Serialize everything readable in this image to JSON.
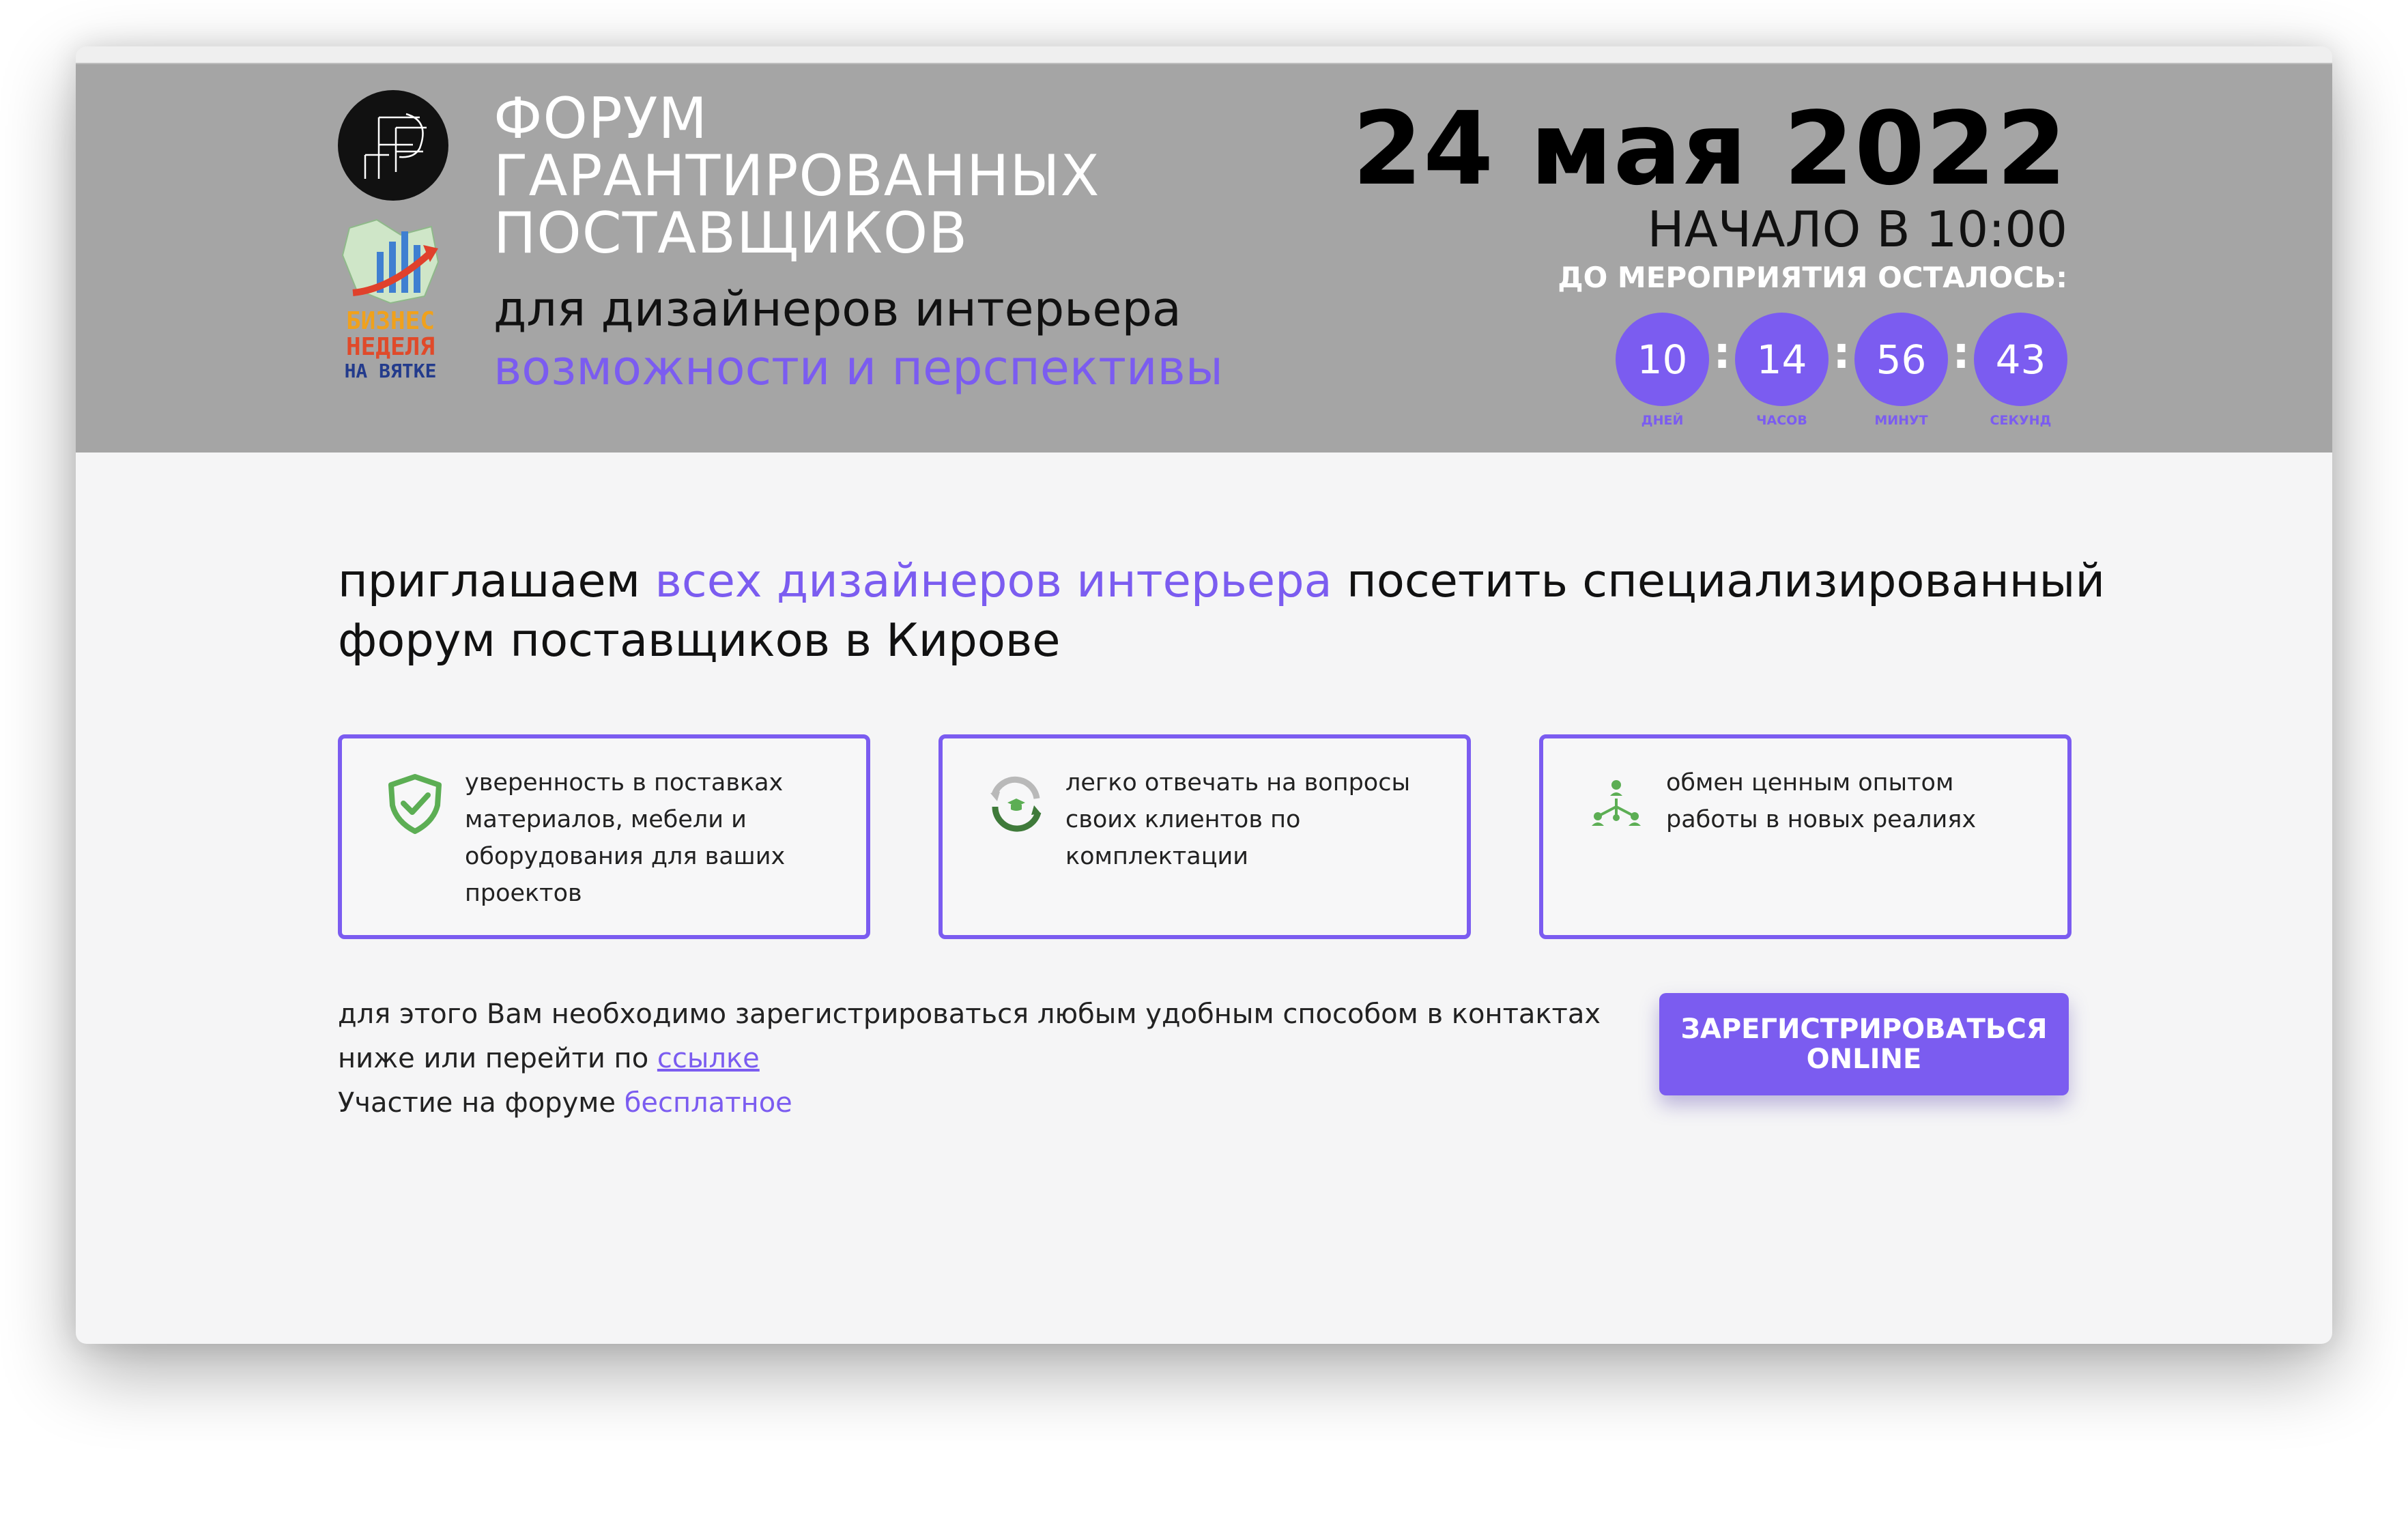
{
  "header": {
    "title_lines": [
      "ФОРУМ",
      "ГАРАНТИРОВАННЫХ",
      "ПОСТАВЩИКОВ"
    ],
    "subtitle": "для дизайнеров интерьера",
    "tagline": "возможности и перспективы",
    "logo_secondary_lines": [
      "БИЗНЕС",
      "НЕДЕЛЯ",
      "НА ВЯТКЕ"
    ],
    "date": "24 мая 2022",
    "start_time": "НАЧАЛО В 10:00",
    "countdown_label": "ДО МЕРОПРИЯТИЯ ОСТАЛОСЬ:",
    "countdown": [
      {
        "value": "10",
        "label": "ДНЕЙ"
      },
      {
        "value": "14",
        "label": "ЧАСОВ"
      },
      {
        "value": "56",
        "label": "МИНУТ"
      },
      {
        "value": "43",
        "label": "СЕКУНД"
      }
    ],
    "countdown_separator": ":"
  },
  "invite": {
    "part1": "приглашаем ",
    "accent": "всех дизайнеров интерьера",
    "part2": " посетить специализированный форум поставщиков в Кирове"
  },
  "cards": [
    {
      "icon": "shield-check-icon",
      "text": "уверенность в поставках материалов, мебели и оборудования для ваших проектов"
    },
    {
      "icon": "cycle-graduation-icon",
      "text": "легко отвечать на вопросы своих клиентов по комплектации"
    },
    {
      "icon": "network-people-icon",
      "text": "обмен ценным опытом работы в новых реалиях"
    }
  ],
  "note": {
    "line1": "для этого Вам необходимо зарегистрироваться любым удобным способом в контактах ниже или перейти по ",
    "link": "ссылке",
    "line2_prefix": "Участие на форуме ",
    "free": "бесплатное"
  },
  "register_button": "ЗАРЕГИСТРИРОВАТЬСЯ ONLINE",
  "colors": {
    "accent": "#7b5cf0",
    "header_bg": "#a5a5a5",
    "page_bg": "#f5f5f6",
    "icon_green": "#5cae54"
  }
}
